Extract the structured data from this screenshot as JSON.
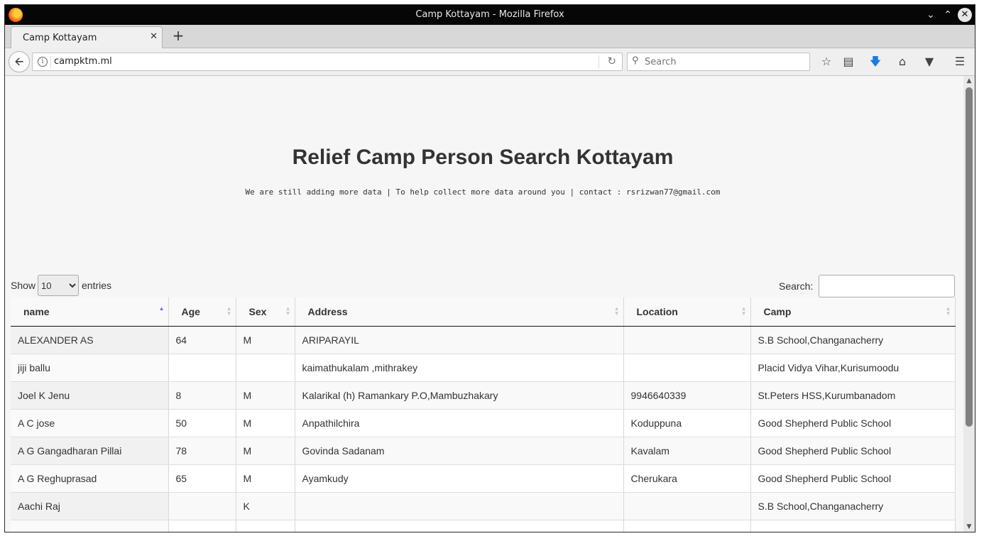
{
  "window": {
    "title": "Camp Kottayam - Mozilla Firefox"
  },
  "browser": {
    "tab_title": "Camp Kottayam",
    "url": "campktm.ml",
    "search_placeholder": "Search"
  },
  "page": {
    "heading": "Relief Camp Person Search Kottayam",
    "subtitle": "We are still adding more data | To help collect more data around you | contact : rsrizwan77@gmail.com",
    "show_label": "Show",
    "entries_label": "entries",
    "page_length": "10",
    "search_label": "Search:"
  },
  "table": {
    "columns": [
      "name",
      "Age",
      "Sex",
      "Address",
      "Location",
      "Camp"
    ],
    "rows": [
      [
        "ALEXANDER AS",
        "64",
        "M",
        "ARIPARAYIL",
        "",
        "S.B School,Changanacherry"
      ],
      [
        "jiji ballu",
        "",
        "",
        "kaimathukalam ,mithrakey",
        "",
        "Placid Vidya Vihar,Kurisumoodu"
      ],
      [
        "Joel K Jenu",
        "8",
        "M",
        "Kalarikal (h) Ramankary P.O,Mambuzhakary",
        "9946640339",
        "St.Peters HSS,Kurumbanadom"
      ],
      [
        "A C jose",
        "50",
        "M",
        "Anpathilchira",
        "Koduppuna",
        "Good Shepherd Public School"
      ],
      [
        "A G Gangadharan Pillai",
        "78",
        "M",
        "Govinda Sadanam",
        "Kavalam",
        "Good Shepherd Public School"
      ],
      [
        "A G Reghuprasad",
        "65",
        "M",
        "Ayamkudy",
        "Cherukara",
        "Good Shepherd Public School"
      ],
      [
        "Aachi Raj",
        "",
        "K",
        "",
        "",
        "S.B School,Changanacherry"
      ],
      [
        "",
        "",
        "",
        "",
        "",
        ""
      ]
    ]
  }
}
